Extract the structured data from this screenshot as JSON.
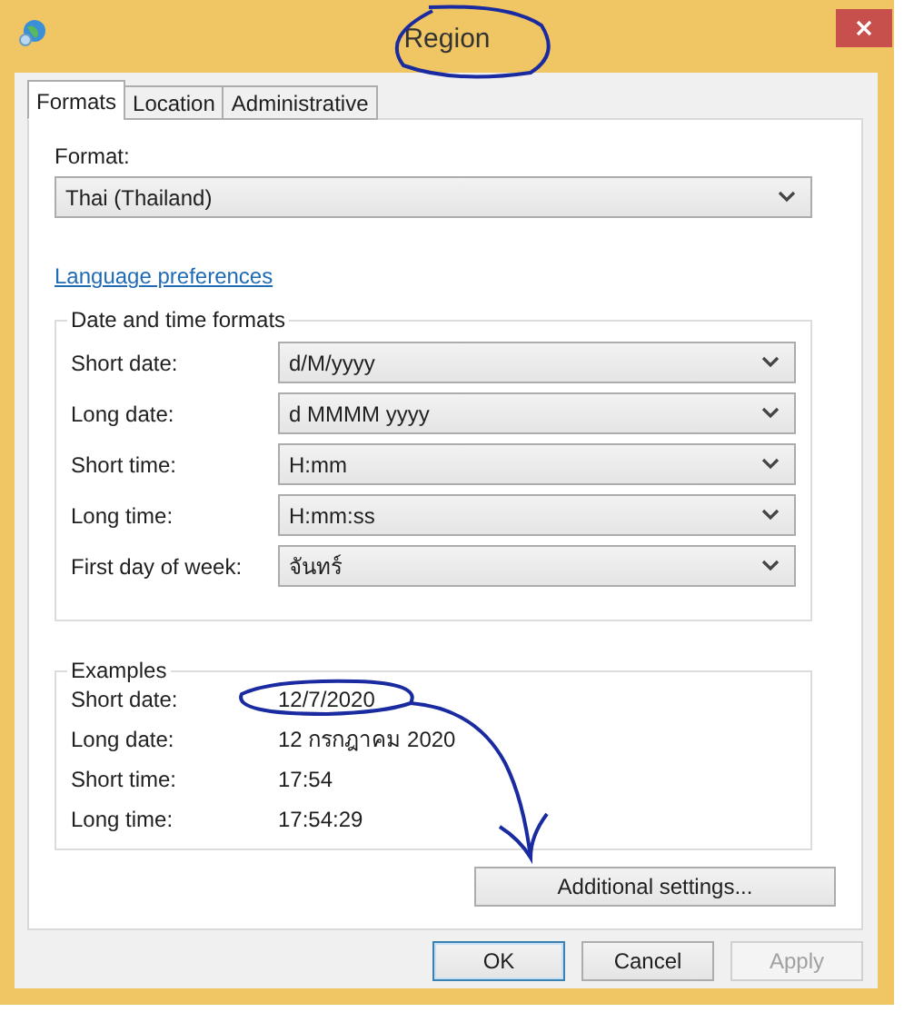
{
  "window": {
    "title": "Region"
  },
  "tabs": [
    {
      "label": "Formats",
      "selected": true
    },
    {
      "label": "Location",
      "selected": false
    },
    {
      "label": "Administrative",
      "selected": false
    }
  ],
  "format": {
    "label": "Format:",
    "value": "Thai (Thailand)"
  },
  "link": "Language preferences",
  "formats_group": {
    "title": "Date and time formats",
    "rows": [
      {
        "label": "Short date:",
        "value": "d/M/yyyy"
      },
      {
        "label": "Long date:",
        "value": "d MMMM yyyy"
      },
      {
        "label": "Short time:",
        "value": "H:mm"
      },
      {
        "label": "Long time:",
        "value": "H:mm:ss"
      },
      {
        "label": "First day of week:",
        "value": "จันทร์"
      }
    ]
  },
  "examples": {
    "title": "Examples",
    "rows": [
      {
        "label": "Short date:",
        "value": "12/7/2020"
      },
      {
        "label": "Long date:",
        "value": "12 กรกฎาคม 2020"
      },
      {
        "label": "Short time:",
        "value": "17:54"
      },
      {
        "label": "Long time:",
        "value": "17:54:29"
      }
    ]
  },
  "additional_button": "Additional settings...",
  "buttons": [
    {
      "label": "OK",
      "default": true,
      "disabled": false
    },
    {
      "label": "Cancel",
      "default": false,
      "disabled": false
    },
    {
      "label": "Apply",
      "default": false,
      "disabled": true
    }
  ]
}
